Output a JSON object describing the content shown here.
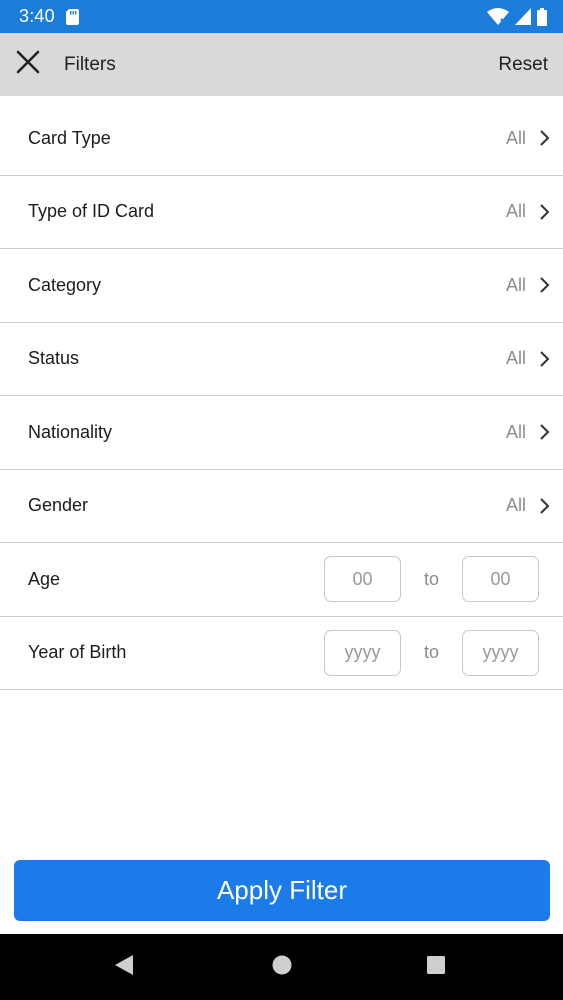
{
  "status_bar": {
    "time": "3:40",
    "icons": [
      "sd-card-icon",
      "wifi-icon",
      "signal-icon",
      "battery-icon"
    ],
    "background": "#1b7cd9"
  },
  "header": {
    "title": "Filters",
    "reset_label": "Reset",
    "close_icon": "close-icon",
    "background": "#d9d9d9"
  },
  "filters": [
    {
      "label": "Card Type",
      "value": "All"
    },
    {
      "label": "Type of ID Card",
      "value": "All"
    },
    {
      "label": "Category",
      "value": "All"
    },
    {
      "label": "Status",
      "value": "All"
    },
    {
      "label": "Nationality",
      "value": "All"
    },
    {
      "label": "Gender",
      "value": "All"
    }
  ],
  "ranges": [
    {
      "label": "Age",
      "from_placeholder": "00",
      "to_label": "to",
      "to_placeholder": "00"
    },
    {
      "label": "Year of Birth",
      "from_placeholder": "yyyy",
      "to_label": "to",
      "to_placeholder": "yyyy"
    }
  ],
  "apply_button": {
    "label": "Apply Filter",
    "color": "#1b7be8"
  },
  "nav_bar": {
    "icons": [
      "back-icon",
      "home-icon",
      "recents-icon"
    ]
  }
}
